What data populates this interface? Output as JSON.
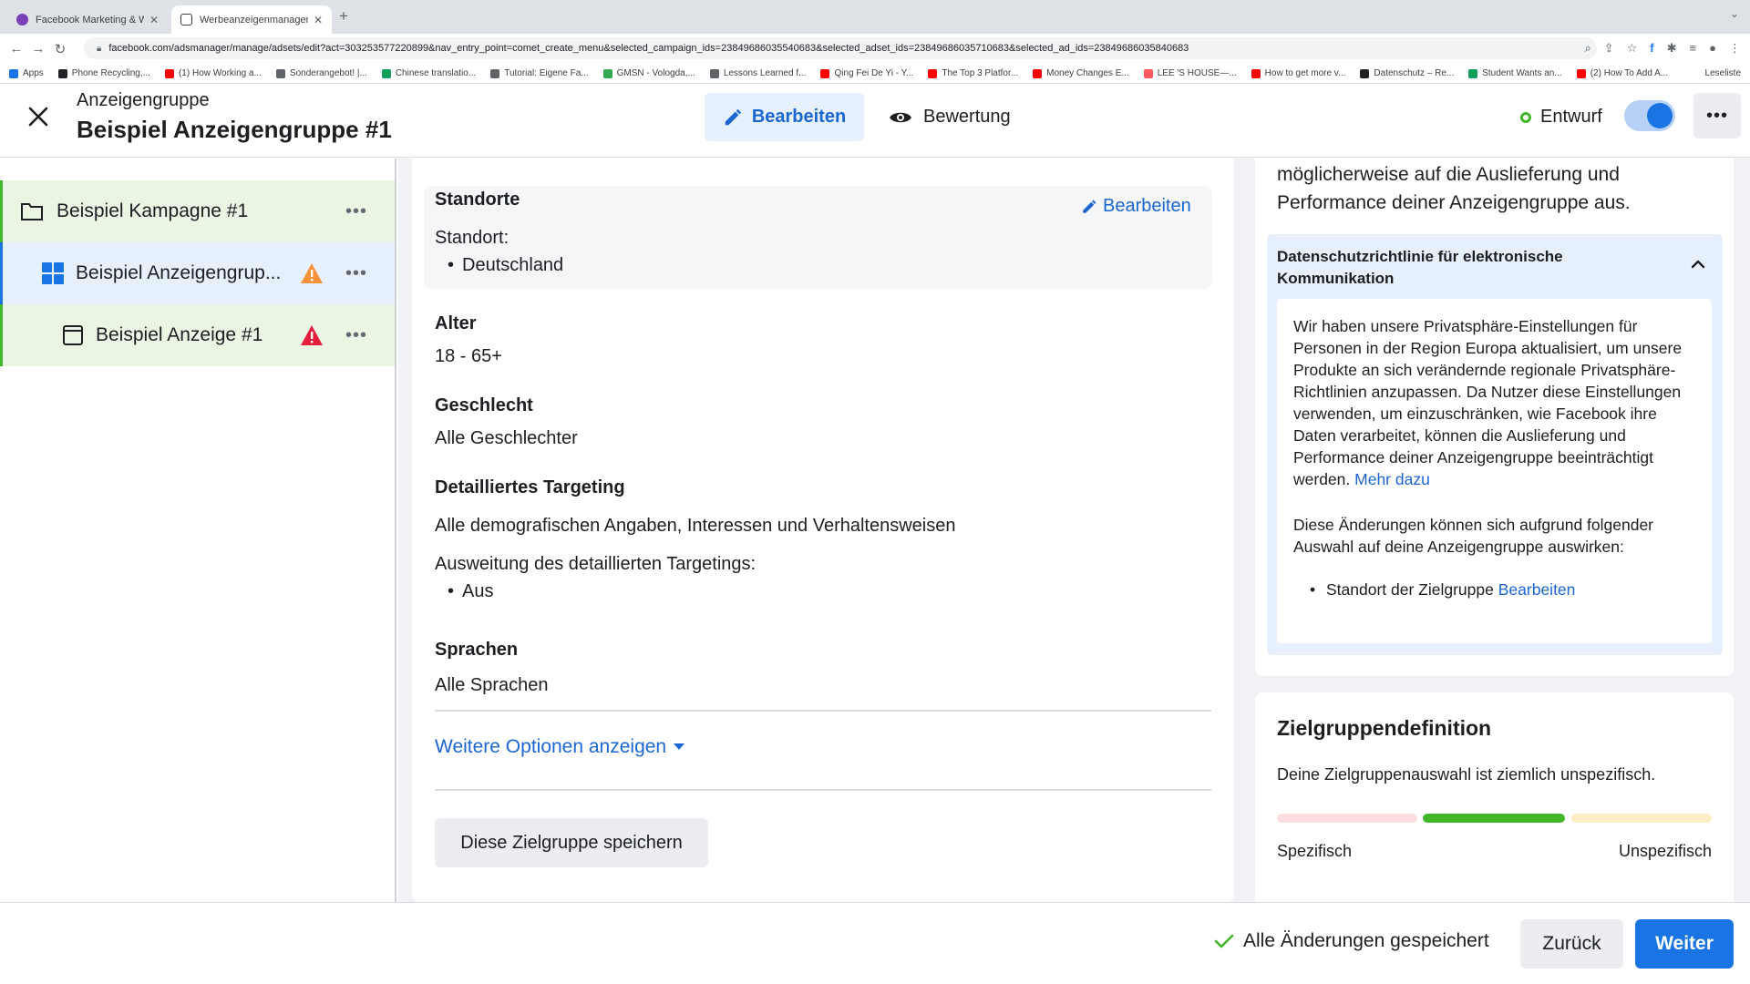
{
  "browser": {
    "tabs": [
      {
        "title": "Facebook Marketing & Werbea",
        "favicon_color": "#7b3fb5"
      },
      {
        "title": "Werbeanzeigenmanager - Wer",
        "favicon_color": "#3c4043"
      }
    ],
    "url": "facebook.com/adsmanager/manage/adsets/edit?act=303253577220899&nav_entry_point=comet_create_menu&selected_campaign_ids=23849686035540683&selected_adset_ids=23849686035710683&selected_ad_ids=23849686035840683",
    "bookmarks": [
      {
        "label": "Apps",
        "color": "#1a73e8"
      },
      {
        "label": "Phone Recycling,...",
        "color": "#202124"
      },
      {
        "label": "(1) How Working a...",
        "color": "#ff0000"
      },
      {
        "label": "Sonderangebot! |...",
        "color": "#5f6368"
      },
      {
        "label": "Chinese translatio...",
        "color": "#0f9d58"
      },
      {
        "label": "Tutorial: Eigene Fa...",
        "color": "#5f6368"
      },
      {
        "label": "GMSN - Vologda,...",
        "color": "#34a853"
      },
      {
        "label": "Lessons Learned f...",
        "color": "#5f6368"
      },
      {
        "label": "Qing Fei De Yi - Y...",
        "color": "#ff0000"
      },
      {
        "label": "The Top 3 Platfor...",
        "color": "#ff0000"
      },
      {
        "label": "Money Changes E...",
        "color": "#ff0000"
      },
      {
        "label": "LEE 'S HOUSE—...",
        "color": "#ff5a5f"
      },
      {
        "label": "How to get more v...",
        "color": "#ff0000"
      },
      {
        "label": "Datenschutz – Re...",
        "color": "#202124"
      },
      {
        "label": "Student Wants an...",
        "color": "#0f9d58"
      },
      {
        "label": "(2) How To Add A...",
        "color": "#ff0000"
      }
    ],
    "reading_list": "Leseliste"
  },
  "header": {
    "subtitle": "Anzeigengruppe",
    "title": "Beispiel Anzeigengruppe #1",
    "edit_tab": "Bearbeiten",
    "review_tab": "Bewertung",
    "status": "Entwurf",
    "accent": "#1b74e4"
  },
  "sidebar": {
    "items": [
      {
        "label": "Beispiel Kampagne #1",
        "icon": "folder-icon",
        "warning": ""
      },
      {
        "label": "Beispiel Anzeigengrup...",
        "icon": "grid-icon",
        "warning": "orange"
      },
      {
        "label": "Beispiel Anzeige #1",
        "icon": "ad-icon",
        "warning": "red"
      }
    ]
  },
  "main": {
    "locations_title": "Standorte",
    "locations_edit": "Bearbeiten",
    "location_label": "Standort:",
    "location_value": "Deutschland",
    "age_title": "Alter",
    "age_value": "18 - 65+",
    "gender_title": "Geschlecht",
    "gender_value": "Alle Geschlechter",
    "targeting_title": "Detailliertes Targeting",
    "targeting_value": "Alle demografischen Angaben, Interessen und Verhaltensweisen",
    "expansion_label": "Ausweitung des detaillierten Targetings:",
    "expansion_value": "Aus",
    "languages_title": "Sprachen",
    "languages_value": "Alle Sprachen",
    "more_options": "Weitere Optionen anzeigen",
    "save_audience": "Diese Zielgruppe speichern"
  },
  "right": {
    "top_text": "möglicherweise auf die Auslieferung und Performance deiner Anzeigengruppe aus.",
    "privacy_title": "Datenschutzrichtlinie für elektronische Kommunikation",
    "privacy_text": "Wir haben unsere Privatsphäre-Einstellungen für Personen in der Region Europa aktualisiert, um unsere Produkte an sich verändernde regionale Privatsphäre-Richtlinien anzupassen. Da Nutzer diese Einstellungen verwenden, um einzuschränken, wie Facebook ihre Daten verarbeitet, können die Auslieferung und Performance deiner Anzeigengruppe beeinträchtigt werden.",
    "privacy_link": "Mehr dazu",
    "privacy_text2": "Diese Änderungen können sich aufgrund folgender Auswahl auf deine Anzeigengruppe auswirken:",
    "privacy_bullet": "Standort der Zielgruppe",
    "privacy_bullet_link": "Bearbeiten",
    "audience_title": "Zielgruppendefinition",
    "audience_text": "Deine Zielgruppenauswahl ist ziemlich unspezifisch.",
    "meter_specific": "Spezifisch",
    "meter_unspecific": "Unspezifisch"
  },
  "footer": {
    "saved": "Alle Änderungen gespeichert",
    "back": "Zurück",
    "next": "Weiter"
  }
}
